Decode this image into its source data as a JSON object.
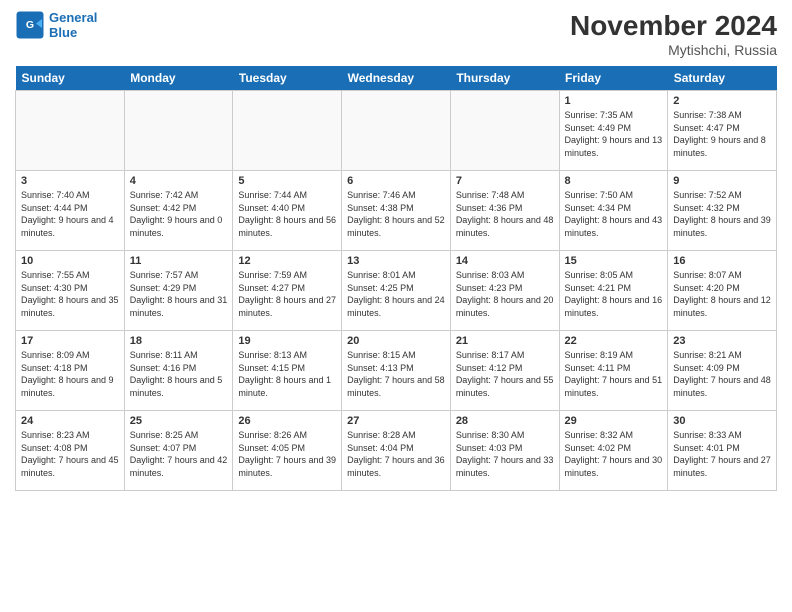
{
  "header": {
    "logo_line1": "General",
    "logo_line2": "Blue",
    "month_title": "November 2024",
    "location": "Mytishchi, Russia"
  },
  "weekdays": [
    "Sunday",
    "Monday",
    "Tuesday",
    "Wednesday",
    "Thursday",
    "Friday",
    "Saturday"
  ],
  "weeks": [
    [
      {
        "day": "",
        "info": ""
      },
      {
        "day": "",
        "info": ""
      },
      {
        "day": "",
        "info": ""
      },
      {
        "day": "",
        "info": ""
      },
      {
        "day": "",
        "info": ""
      },
      {
        "day": "1",
        "info": "Sunrise: 7:35 AM\nSunset: 4:49 PM\nDaylight: 9 hours and 13 minutes."
      },
      {
        "day": "2",
        "info": "Sunrise: 7:38 AM\nSunset: 4:47 PM\nDaylight: 9 hours and 8 minutes."
      }
    ],
    [
      {
        "day": "3",
        "info": "Sunrise: 7:40 AM\nSunset: 4:44 PM\nDaylight: 9 hours and 4 minutes."
      },
      {
        "day": "4",
        "info": "Sunrise: 7:42 AM\nSunset: 4:42 PM\nDaylight: 9 hours and 0 minutes."
      },
      {
        "day": "5",
        "info": "Sunrise: 7:44 AM\nSunset: 4:40 PM\nDaylight: 8 hours and 56 minutes."
      },
      {
        "day": "6",
        "info": "Sunrise: 7:46 AM\nSunset: 4:38 PM\nDaylight: 8 hours and 52 minutes."
      },
      {
        "day": "7",
        "info": "Sunrise: 7:48 AM\nSunset: 4:36 PM\nDaylight: 8 hours and 48 minutes."
      },
      {
        "day": "8",
        "info": "Sunrise: 7:50 AM\nSunset: 4:34 PM\nDaylight: 8 hours and 43 minutes."
      },
      {
        "day": "9",
        "info": "Sunrise: 7:52 AM\nSunset: 4:32 PM\nDaylight: 8 hours and 39 minutes."
      }
    ],
    [
      {
        "day": "10",
        "info": "Sunrise: 7:55 AM\nSunset: 4:30 PM\nDaylight: 8 hours and 35 minutes."
      },
      {
        "day": "11",
        "info": "Sunrise: 7:57 AM\nSunset: 4:29 PM\nDaylight: 8 hours and 31 minutes."
      },
      {
        "day": "12",
        "info": "Sunrise: 7:59 AM\nSunset: 4:27 PM\nDaylight: 8 hours and 27 minutes."
      },
      {
        "day": "13",
        "info": "Sunrise: 8:01 AM\nSunset: 4:25 PM\nDaylight: 8 hours and 24 minutes."
      },
      {
        "day": "14",
        "info": "Sunrise: 8:03 AM\nSunset: 4:23 PM\nDaylight: 8 hours and 20 minutes."
      },
      {
        "day": "15",
        "info": "Sunrise: 8:05 AM\nSunset: 4:21 PM\nDaylight: 8 hours and 16 minutes."
      },
      {
        "day": "16",
        "info": "Sunrise: 8:07 AM\nSunset: 4:20 PM\nDaylight: 8 hours and 12 minutes."
      }
    ],
    [
      {
        "day": "17",
        "info": "Sunrise: 8:09 AM\nSunset: 4:18 PM\nDaylight: 8 hours and 9 minutes."
      },
      {
        "day": "18",
        "info": "Sunrise: 8:11 AM\nSunset: 4:16 PM\nDaylight: 8 hours and 5 minutes."
      },
      {
        "day": "19",
        "info": "Sunrise: 8:13 AM\nSunset: 4:15 PM\nDaylight: 8 hours and 1 minute."
      },
      {
        "day": "20",
        "info": "Sunrise: 8:15 AM\nSunset: 4:13 PM\nDaylight: 7 hours and 58 minutes."
      },
      {
        "day": "21",
        "info": "Sunrise: 8:17 AM\nSunset: 4:12 PM\nDaylight: 7 hours and 55 minutes."
      },
      {
        "day": "22",
        "info": "Sunrise: 8:19 AM\nSunset: 4:11 PM\nDaylight: 7 hours and 51 minutes."
      },
      {
        "day": "23",
        "info": "Sunrise: 8:21 AM\nSunset: 4:09 PM\nDaylight: 7 hours and 48 minutes."
      }
    ],
    [
      {
        "day": "24",
        "info": "Sunrise: 8:23 AM\nSunset: 4:08 PM\nDaylight: 7 hours and 45 minutes."
      },
      {
        "day": "25",
        "info": "Sunrise: 8:25 AM\nSunset: 4:07 PM\nDaylight: 7 hours and 42 minutes."
      },
      {
        "day": "26",
        "info": "Sunrise: 8:26 AM\nSunset: 4:05 PM\nDaylight: 7 hours and 39 minutes."
      },
      {
        "day": "27",
        "info": "Sunrise: 8:28 AM\nSunset: 4:04 PM\nDaylight: 7 hours and 36 minutes."
      },
      {
        "day": "28",
        "info": "Sunrise: 8:30 AM\nSunset: 4:03 PM\nDaylight: 7 hours and 33 minutes."
      },
      {
        "day": "29",
        "info": "Sunrise: 8:32 AM\nSunset: 4:02 PM\nDaylight: 7 hours and 30 minutes."
      },
      {
        "day": "30",
        "info": "Sunrise: 8:33 AM\nSunset: 4:01 PM\nDaylight: 7 hours and 27 minutes."
      }
    ]
  ]
}
